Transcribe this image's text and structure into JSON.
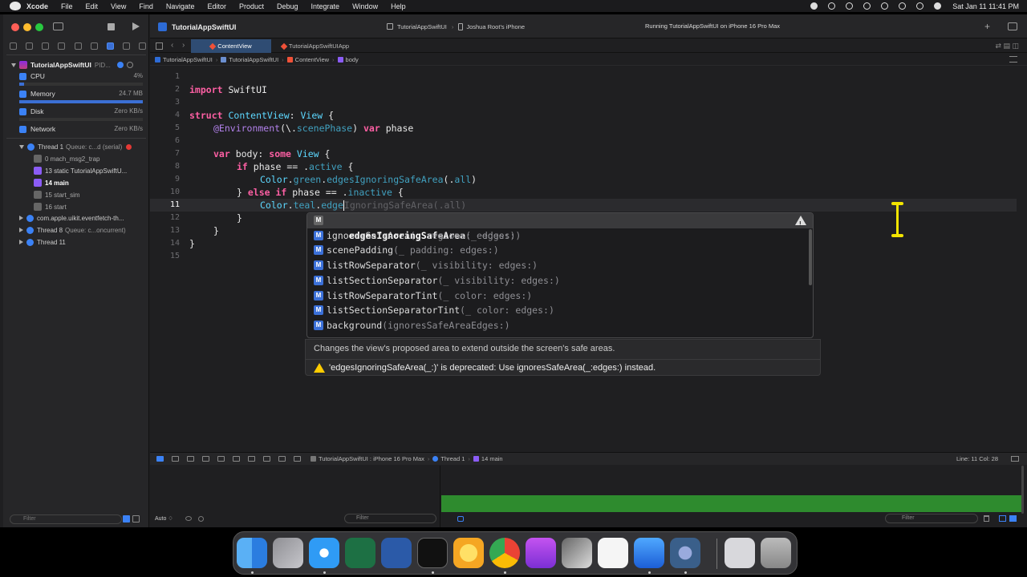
{
  "menubar": {
    "app": "Xcode",
    "items": [
      "File",
      "Edit",
      "View",
      "Find",
      "Navigate",
      "Editor",
      "Product",
      "Debug",
      "Integrate",
      "Window",
      "Help"
    ],
    "clock": "Sat Jan 11  11:41 PM"
  },
  "toolbar": {
    "project_title": "TutorialAppSwiftUI",
    "scheme": "TutorialAppSwiftUI",
    "device": "Joshua Root's iPhone",
    "status": "Running TutorialAppSwiftUI on iPhone 16 Pro Max"
  },
  "navigator": {
    "process": {
      "name": "TutorialAppSwiftUI",
      "pid": "PID..."
    },
    "gauges": [
      {
        "label": "CPU",
        "value": "4%",
        "fill": 0.04
      },
      {
        "label": "Memory",
        "value": "24.7 MB",
        "fill": 1.0
      },
      {
        "label": "Disk",
        "value": "Zero KB/s",
        "fill": 0
      },
      {
        "label": "Network",
        "value": "Zero KB/s",
        "fill": 0
      }
    ],
    "thread1": {
      "name": "Thread 1",
      "queue": "Queue: c...d (serial)"
    },
    "frames": [
      "0 mach_msg2_trap",
      "13 static TutorialAppSwiftU...",
      "14 main",
      "15 start_sim",
      "16 start"
    ],
    "other_threads": [
      {
        "name": "com.apple.uikit.eventfetch-th...",
        "queue": ""
      },
      {
        "name": "Thread 8",
        "queue": "Queue: c...oncurrent)"
      },
      {
        "name": "Thread 11",
        "queue": ""
      }
    ],
    "filter_placeholder": "Filter"
  },
  "doc_tabs": [
    "ContentView",
    "TutorialAppSwiftUIApp"
  ],
  "jumpbar": [
    "TutorialAppSwiftUI",
    "TutorialAppSwiftUI",
    "ContentView",
    "body"
  ],
  "editor": {
    "line_numbers": [
      "1",
      "2",
      "3",
      "4",
      "5",
      "6",
      "7",
      "8",
      "9",
      "10",
      "11",
      "12",
      "13",
      "14",
      "15"
    ],
    "current_line": "11",
    "lines": {
      "l2_kw": "import",
      "l2_rest": " SwiftUI",
      "l4_kw": "struct",
      "l4_name": " ContentView",
      "l4_colon": ": ",
      "l4_type": "View",
      "l4_brace": " {",
      "l5_attr": "@Environment",
      "l5_open": "(\\.",
      "l5_prop": "scenePhase",
      "l5_close": ") ",
      "l5_var": "var",
      "l5_name": " phase",
      "l7_var": "var",
      "l7_body": " body",
      "l7_colon": ": ",
      "l7_some": "some",
      "l7_sp": " ",
      "l7_view": "View",
      "l7_brace": " {",
      "l8_if": "if",
      "l8_phase": " phase",
      "l8_eq": " == .",
      "l8_case": "active",
      "l8_brace": " {",
      "l9_color": "Color",
      "l9_dot": ".",
      "l9_green": "green",
      "l9_dot2": ".",
      "l9_fn": "edgesIgnoringSafeArea",
      "l9_args": "(.",
      "l9_all": "all",
      "l9_close": ")",
      "l10_close": "} ",
      "l10_else": "else",
      "l10_sp": " ",
      "l10_if": "if",
      "l10_phase": " phase",
      "l10_eq": " == .",
      "l10_case": "inactive",
      "l10_brace": " {",
      "l11_color": "Color",
      "l11_dot": ".",
      "l11_teal": "teal",
      "l11_dot2": ".",
      "l11_typed": "edge",
      "l11_ghost": "IgnoringSafeArea(.all)",
      "l12": "}",
      "l13": "}",
      "l14": "}"
    }
  },
  "completion": {
    "items": [
      {
        "badge": "M",
        "strong": "edgesIgnoringSafeArea",
        "sig": "(_ edges:)",
        "deprecated": true
      },
      {
        "badge": "M",
        "strong": "ignoresSafeArea",
        "sig": "(_ regions: edges:)"
      },
      {
        "badge": "M",
        "strong": "scenePadding",
        "sig": "(_ padding: edges:)"
      },
      {
        "badge": "M",
        "strong": "listRowSeparator",
        "sig": "(_ visibility: edges:)"
      },
      {
        "badge": "M",
        "strong": "listSectionSeparator",
        "sig": "(_ visibility: edges:)"
      },
      {
        "badge": "M",
        "strong": "listRowSeparatorTint",
        "sig": "(_ color: edges:)"
      },
      {
        "badge": "M",
        "strong": "listSectionSeparatorTint",
        "sig": "(_ color: edges:)"
      },
      {
        "badge": "M",
        "strong": "background",
        "sig": "(ignoresSafeAreaEdges:)"
      }
    ],
    "description": "Changes the view's proposed area to extend outside the screen's safe areas.",
    "warning": "'edgesIgnoringSafeArea(_:)' is deprecated: Use ignoresSafeArea(_:edges:) instead."
  },
  "debugbar": {
    "crumbs": [
      "TutorialAppSwiftUI : iPhone 16 Pro Max",
      "Thread 1",
      "14 main"
    ],
    "line_col": "Line: 11  Col: 28"
  },
  "bottom": {
    "auto_label": "Auto ♢",
    "vars_filter": "Filter",
    "console_filter": "Filter"
  },
  "colors": {
    "accent": "#3b82f6",
    "console_green": "#2e8b2e"
  }
}
